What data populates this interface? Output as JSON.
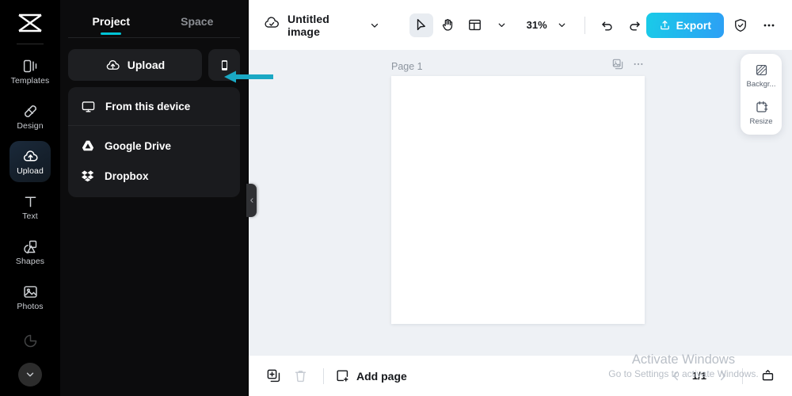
{
  "app": {
    "brand_name": "capcut-logo",
    "accent_cyan": "#00c4d6",
    "annotation_color": "#1aa8c4"
  },
  "rail": {
    "items": [
      {
        "label": "Templates",
        "icon": "templates-icon",
        "active": false
      },
      {
        "label": "Design",
        "icon": "design-icon",
        "active": false
      },
      {
        "label": "Upload",
        "icon": "upload-cloud-icon",
        "active": true
      },
      {
        "label": "Text",
        "icon": "text-icon",
        "active": false
      },
      {
        "label": "Shapes",
        "icon": "shapes-icon",
        "active": false
      },
      {
        "label": "Photos",
        "icon": "photos-icon",
        "active": false
      },
      {
        "label": "",
        "icon": "color-icon",
        "active": false
      }
    ],
    "expand_icon": "chevron-down-icon"
  },
  "panel": {
    "tabs": [
      {
        "label": "Project",
        "active": true
      },
      {
        "label": "Space",
        "active": false
      }
    ],
    "upload_button": {
      "label": "Upload",
      "icon": "upload-cloud-icon"
    },
    "mobile_button": {
      "icon": "mobile-phone-icon"
    },
    "menu": {
      "primary": [
        {
          "label": "From this device",
          "icon": "monitor-icon"
        }
      ],
      "cloud": [
        {
          "label": "Google Drive",
          "icon": "google-drive-icon"
        },
        {
          "label": "Dropbox",
          "icon": "dropbox-icon"
        }
      ]
    },
    "collapse_icon": "chevron-left-icon"
  },
  "toolbar": {
    "cloud_icon": "cloud-saved-icon",
    "doc_title": "Untitled image",
    "title_chevron": "chevron-down-icon",
    "tools": [
      {
        "name": "select-tool",
        "icon": "cursor-arrow-icon",
        "selected": true
      },
      {
        "name": "hand-tool",
        "icon": "hand-icon",
        "selected": false
      },
      {
        "name": "layout-tool",
        "icon": "layout-grid-icon",
        "selected": false
      }
    ],
    "layout_chevron": "chevron-down-icon",
    "zoom_level": "31%",
    "zoom_chevron": "chevron-down-icon",
    "undo_icon": "undo-icon",
    "redo_icon": "redo-icon",
    "export_label": "Export",
    "export_icon": "export-upload-icon",
    "shield_icon": "shield-check-icon",
    "more_icon": "more-horizontal-icon"
  },
  "canvas": {
    "page_label": "Page 1",
    "duplicate_icon": "duplicate-page-icon",
    "more_icon": "more-horizontal-icon",
    "float_panel": [
      {
        "label": "Backgr...",
        "icon": "background-icon"
      },
      {
        "label": "Resize",
        "icon": "resize-icon"
      }
    ]
  },
  "bottombar": {
    "duplicate_icon": "duplicate-icon",
    "delete_icon": "trash-icon",
    "add_page_label": "Add page",
    "add_page_icon": "add-page-icon",
    "prev_icon": "chevron-left-icon",
    "page_count": "1/1",
    "next_icon": "chevron-right-icon",
    "present_icon": "present-icon"
  },
  "watermark": {
    "line1": "Activate Windows",
    "line2": "Go to Settings to activate Windows."
  }
}
